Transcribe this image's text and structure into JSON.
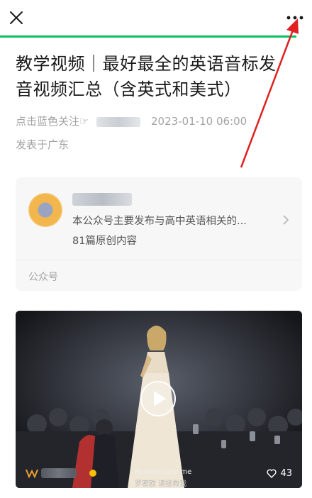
{
  "article": {
    "title": "教学视频｜最好最全的英语音标发音视频汇总（含英式和美式）",
    "follow_prompt": "点击蓝色关注☞",
    "author_name": "",
    "date": "2023-01-10 06:00",
    "location": "发表于广东"
  },
  "account_card": {
    "name": "",
    "description": "本公众号主要发布与高中英语相关的...",
    "original_count": "81篇原创内容",
    "label": "公众号"
  },
  "video": {
    "subtitle_en": "Romeo save me",
    "subtitle_cn": "罗密欧 请拯救我",
    "likes": "43"
  },
  "colors": {
    "progress": "#07c160",
    "annotation": "#e02020"
  }
}
